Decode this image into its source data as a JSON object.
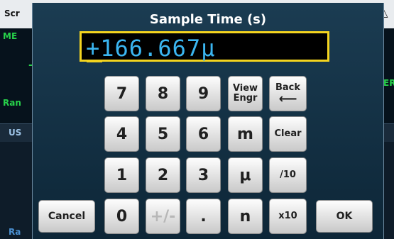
{
  "background": {
    "top_left": "Scr",
    "green_left_1": "ME",
    "green_right": "ER",
    "green_left_2": "Ran",
    "tab_left": "US",
    "bottom_left": "Ra",
    "triangle_icon": "warning-triangle-icon"
  },
  "dialog": {
    "title": "Sample Time (s)",
    "value": "+166.667μ",
    "keys": {
      "k7": "7",
      "k8": "8",
      "k9": "9",
      "view_engr_1": "View",
      "view_engr_2": "Engr",
      "back": "Back",
      "k4": "4",
      "k5": "5",
      "k6": "6",
      "m": "m",
      "clear": "Clear",
      "k1": "1",
      "k2": "2",
      "k3": "3",
      "mu": "μ",
      "div10": "/10",
      "cancel": "Cancel",
      "k0": "0",
      "plusminus": "+/-",
      "dot": ".",
      "n": "n",
      "x10": "x10",
      "ok": "OK"
    }
  },
  "colors": {
    "value_text": "#3bb6f1",
    "entry_border": "#f4d41f",
    "green_text": "#27d14a"
  }
}
